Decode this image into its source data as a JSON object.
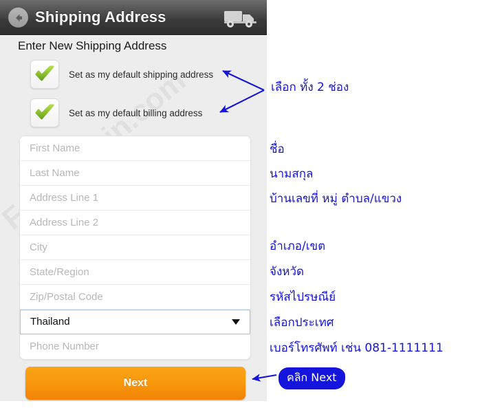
{
  "header": {
    "title": "Shipping Address",
    "back_icon": "back-arrow-icon",
    "truck_icon": "delivery-truck-icon"
  },
  "section": {
    "heading": "Enter New Shipping Address"
  },
  "checkboxes": [
    {
      "label": "Set as my default shipping address",
      "checked": true,
      "icon": "green-check-icon"
    },
    {
      "label": "Set as my default billing address",
      "checked": true,
      "icon": "green-check-icon"
    }
  ],
  "form": {
    "fields": [
      {
        "placeholder": "First Name",
        "value": ""
      },
      {
        "placeholder": "Last Name",
        "value": ""
      },
      {
        "placeholder": "Address Line 1",
        "value": ""
      },
      {
        "placeholder": "Address Line 2",
        "value": ""
      },
      {
        "placeholder": "City",
        "value": ""
      },
      {
        "placeholder": "State/Region",
        "value": ""
      },
      {
        "placeholder": "Zip/Postal Code",
        "value": ""
      }
    ],
    "country_select": {
      "selected": "Thailand",
      "caret_icon": "chevron-down-icon"
    },
    "phone": {
      "placeholder": "Phone Number",
      "value": ""
    }
  },
  "actions": {
    "next_label": "Next"
  },
  "watermark": {
    "text": "ForVitamin.com"
  },
  "annotations": {
    "color": "#1414dc",
    "checkboxes": "เลือก ทั้ง 2 ช่อง",
    "first_name": "ชื่อ",
    "last_name": "นามสกุล",
    "address1": "บ้านเลขที่ หมู่ ตำบล/แขวง",
    "city": "อำเภอ/เขต",
    "state": "จังหวัด",
    "zip": "รหัสไปรษณีย์",
    "country": "เลือกประเทศ",
    "phone": "เบอร์โทรศัพท์ เช่น 081-1111111",
    "next_badge": "คลิก Next"
  }
}
